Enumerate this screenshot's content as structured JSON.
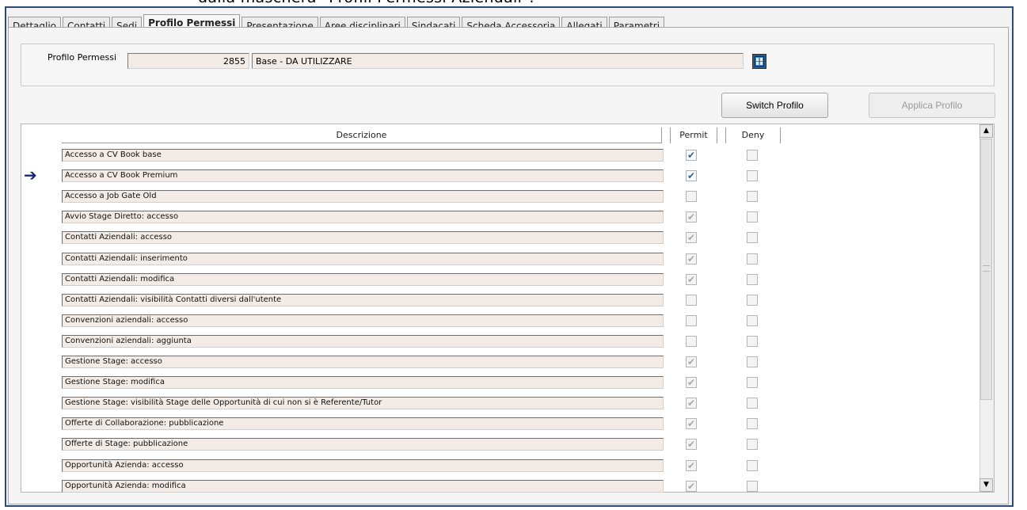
{
  "top_text": "dalla maschera \"Profili Permessi Aziendali\":",
  "tabs": [
    {
      "label": "Dettaglio",
      "active": false
    },
    {
      "label": "Contatti",
      "active": false
    },
    {
      "label": "Sedi",
      "active": false
    },
    {
      "label": "Profilo Permessi",
      "active": true
    },
    {
      "label": "Presentazione",
      "active": false
    },
    {
      "label": "Aree disciplinari",
      "active": false
    },
    {
      "label": "Sindacati",
      "active": false
    },
    {
      "label": "Scheda Accessoria",
      "active": false
    },
    {
      "label": "Allegati",
      "active": false
    },
    {
      "label": "Parametri",
      "active": false
    }
  ],
  "profile": {
    "label": "Profilo Permessi",
    "code": "2855",
    "description": "Base - DA UTILIZZARE",
    "lookup_icon": "lookup-icon"
  },
  "buttons": {
    "switch": "Switch Profilo",
    "apply": "Applica Profilo"
  },
  "table": {
    "headers": {
      "description": "Descrizione",
      "permit": "Permit",
      "deny": "Deny"
    },
    "current_row_indicator": "➔",
    "rows": [
      {
        "desc": "Accesso a CV Book base",
        "permit": "checked",
        "deny": false,
        "current": false
      },
      {
        "desc": "Accesso a CV Book Premium",
        "permit": "checked",
        "deny": false,
        "current": true
      },
      {
        "desc": "Accesso a Job Gate Old",
        "permit": "unchecked",
        "deny": false,
        "current": false
      },
      {
        "desc": "Avvio Stage Diretto: accesso",
        "permit": "checked-dim",
        "deny": false,
        "current": false
      },
      {
        "desc": "Contatti Aziendali: accesso",
        "permit": "checked-dim",
        "deny": false,
        "current": false
      },
      {
        "desc": "Contatti Aziendali: inserimento",
        "permit": "checked-dim",
        "deny": false,
        "current": false
      },
      {
        "desc": "Contatti Aziendali: modifica",
        "permit": "checked-dim",
        "deny": false,
        "current": false
      },
      {
        "desc": "Contatti Aziendali: visibilità Contatti diversi dall'utente",
        "permit": "unchecked",
        "deny": false,
        "current": false
      },
      {
        "desc": "Convenzioni aziendali: accesso",
        "permit": "unchecked",
        "deny": false,
        "current": false
      },
      {
        "desc": "Convenzioni aziendali: aggiunta",
        "permit": "unchecked",
        "deny": false,
        "current": false
      },
      {
        "desc": "Gestione Stage: accesso",
        "permit": "checked-dim",
        "deny": false,
        "current": false
      },
      {
        "desc": "Gestione Stage: modifica",
        "permit": "checked-dim",
        "deny": false,
        "current": false
      },
      {
        "desc": "Gestione Stage: visibilità Stage delle Opportunità di cui non si è Referente/Tutor",
        "permit": "checked-dim",
        "deny": false,
        "current": false
      },
      {
        "desc": "Offerte di Collaborazione: pubblicazione",
        "permit": "checked-dim",
        "deny": false,
        "current": false
      },
      {
        "desc": "Offerte di Stage: pubblicazione",
        "permit": "checked-dim",
        "deny": false,
        "current": false
      },
      {
        "desc": "Opportunità Azienda: accesso",
        "permit": "checked-dim",
        "deny": false,
        "current": false
      },
      {
        "desc": "Opportunità Azienda: modifica",
        "permit": "checked-dim",
        "deny": false,
        "current": false
      }
    ]
  },
  "scrollbar": {
    "up": "▲",
    "down": "▼"
  }
}
